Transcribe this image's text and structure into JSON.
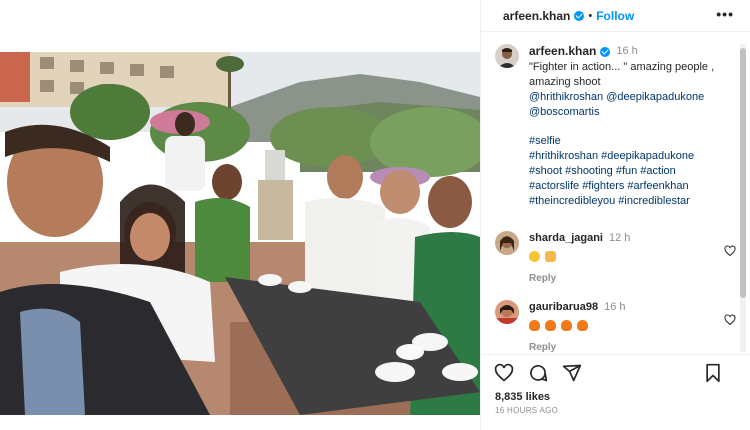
{
  "post": {
    "author": "arfeen.khan",
    "follow_label": "Follow",
    "more_label": "•••",
    "header_separator": "•"
  },
  "caption": {
    "username": "arfeen.khan",
    "time": "16 h",
    "text": "\"Fighter in action... \" amazing people , amazing shoot",
    "mentions": [
      "@hrithikroshan",
      "@deepikapadukone",
      "@boscomartis"
    ],
    "hashtag_lines": [
      "#selfie",
      "#hrithikroshan #deepikapadukone",
      "#shoot #shooting #fun #action",
      "#actorslife #fighters #arfeenkhan",
      "#theincredibleyou #incrediblestar"
    ]
  },
  "comments": [
    {
      "username": "sharda_jagani",
      "time": "12 h",
      "emojis": [
        "heart-eyes",
        "raised-hands"
      ],
      "reply_label": "Reply"
    },
    {
      "username": "gauribarua98",
      "time": "16 h",
      "emojis": [
        "fire",
        "fire",
        "fire",
        "fire"
      ],
      "reply_label": "Reply"
    }
  ],
  "footer": {
    "likes": "8,835 likes",
    "date": "16 HOURS AGO"
  },
  "icons": {
    "like": "heart-icon",
    "comment": "comment-icon",
    "share": "share-icon",
    "save": "bookmark-icon",
    "verified": "verified-badge-icon"
  },
  "colors": {
    "accent": "#0095f6",
    "mention": "#00376b",
    "muted": "#8e8e8e"
  }
}
